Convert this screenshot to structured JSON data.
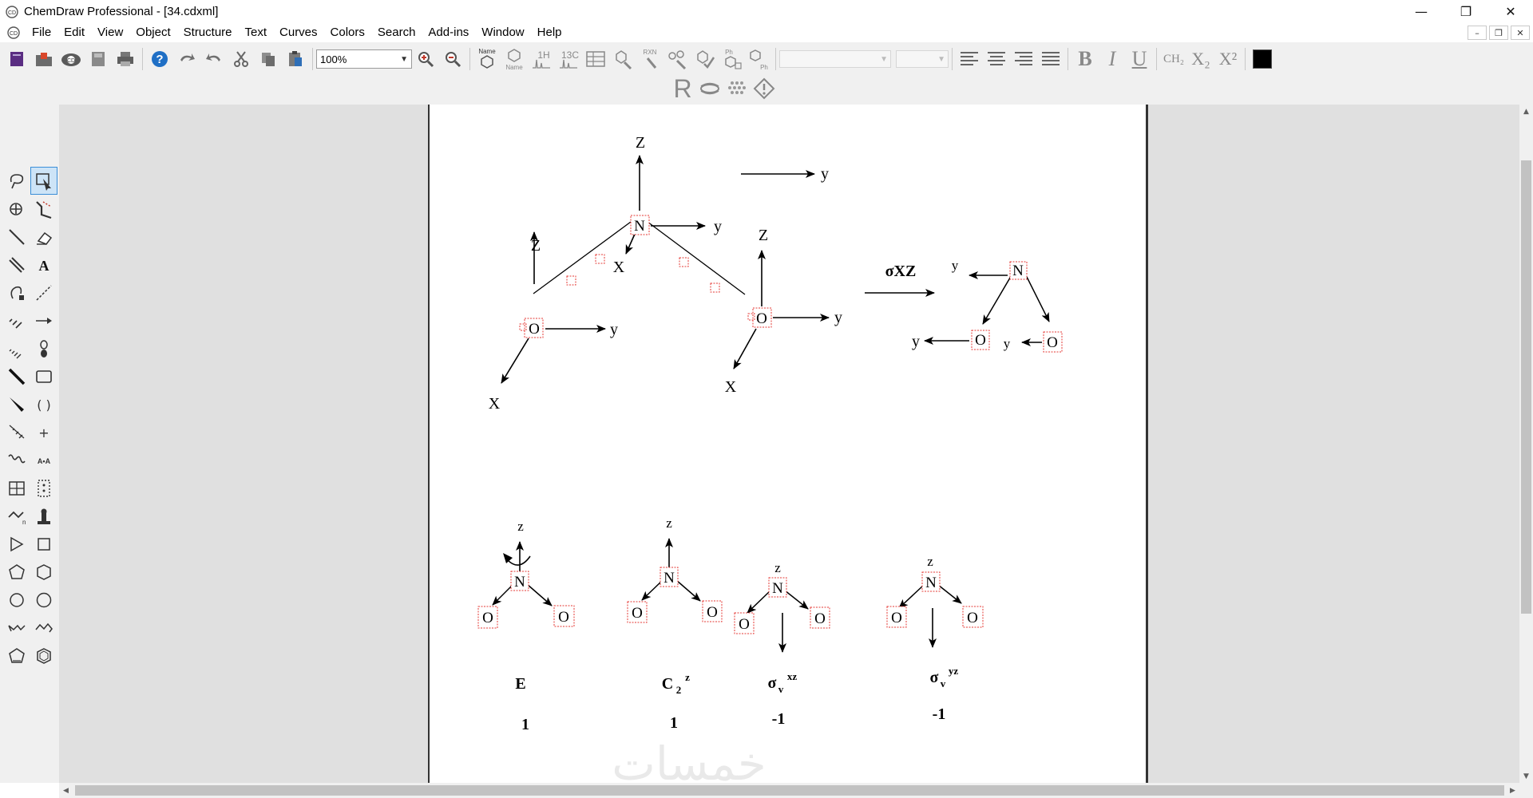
{
  "window": {
    "title": "ChemDraw Professional - [34.cdxml]",
    "controls": {
      "minimize": "—",
      "restore": "❐",
      "close": "✕"
    },
    "mdi_controls": {
      "minimize": "–",
      "restore": "❐",
      "close": "✕"
    }
  },
  "menu": {
    "items": [
      "File",
      "Edit",
      "View",
      "Object",
      "Structure",
      "Text",
      "Curves",
      "Colors",
      "Search",
      "Add-ins",
      "Window",
      "Help"
    ]
  },
  "toolbar": {
    "zoom_value": "100%",
    "chem_labels": {
      "name": "Name",
      "name2": "Name",
      "h1": "1H",
      "c13": "13C",
      "rxn": "RXN",
      "ph": "Ph",
      "ph2": "Ph"
    },
    "format": {
      "bold": "B",
      "italic": "I",
      "underline": "U",
      "ch2": "CH₂",
      "subscript": "X₂",
      "superscript": "X²"
    },
    "row2_r": "R",
    "text_color": "#000000"
  },
  "palette": {
    "tools": [
      "lasso-tool",
      "marquee-select-tool",
      "rotate-tool",
      "chain-tool",
      "solid-bond-tool",
      "eraser-tool",
      "multiple-bond-tool",
      "text-tool",
      "pen-tool",
      "mass-fragment-tool",
      "dashed-bond-tool",
      "arrow-tool",
      "hashed-bond-tool",
      "orbital-tool",
      "bold-bond-tool",
      "drawing-elements-tool",
      "wedge-bond-tool",
      "brackets-tool",
      "hashed-wedge-bond-tool",
      "charge-tool",
      "wavy-bond-tool",
      "query-tool",
      "table-tool",
      "tlc-plate-tool",
      "acyclic-chain-tool",
      "template-stamp-tool",
      "cyclopropane-tool",
      "cyclobutane-tool",
      "cyclopentane-tool",
      "cyclohexane-tool",
      "cycloheptane-tool",
      "cyclooctane-tool",
      "chair-left-tool",
      "chair-right-tool",
      "cyclopentadiene-tool",
      "benzene-tool"
    ],
    "active_tool": "marquee-select-tool"
  },
  "document": {
    "diagram_top": {
      "atoms": {
        "n": "N",
        "o_left": "O",
        "o_right": "O"
      },
      "axes": {
        "n_z": "Z",
        "n_y": "y",
        "n_x": "X",
        "o_left_z": "Z",
        "o_left_y": "y",
        "o_left_x": "X",
        "o_right_z": "Z",
        "o_right_y": "y",
        "o_right_x": "X",
        "ref_y": "y"
      },
      "operation": "σXZ",
      "result": {
        "atoms": {
          "n": "N",
          "o_left": "O",
          "o_right": "O"
        },
        "axes": {
          "n_y": "y",
          "o_left_y": "y",
          "o_right_y": "y"
        }
      }
    },
    "symmetry_ops": [
      {
        "atom_n": "N",
        "atom_o1": "O",
        "atom_o2": "O",
        "axis": "z",
        "label": "E",
        "label_sub": "",
        "label_sup": "",
        "character": "1"
      },
      {
        "atom_n": "N",
        "atom_o1": "O",
        "atom_o2": "O",
        "axis": "z",
        "label": "C",
        "label_sub": "2",
        "label_sup": "z",
        "character": "1"
      },
      {
        "atom_n": "N",
        "atom_o1": "O",
        "atom_o2": "O",
        "axis": "z",
        "label": "σ",
        "label_sub": "v",
        "label_sup": "xz",
        "character": "-1"
      },
      {
        "atom_n": "N",
        "atom_o1": "O",
        "atom_o2": "O",
        "axis": "z",
        "label": "σ",
        "label_sub": "v",
        "label_sup": "yz",
        "character": "-1"
      }
    ],
    "watermark": "خمسات"
  }
}
